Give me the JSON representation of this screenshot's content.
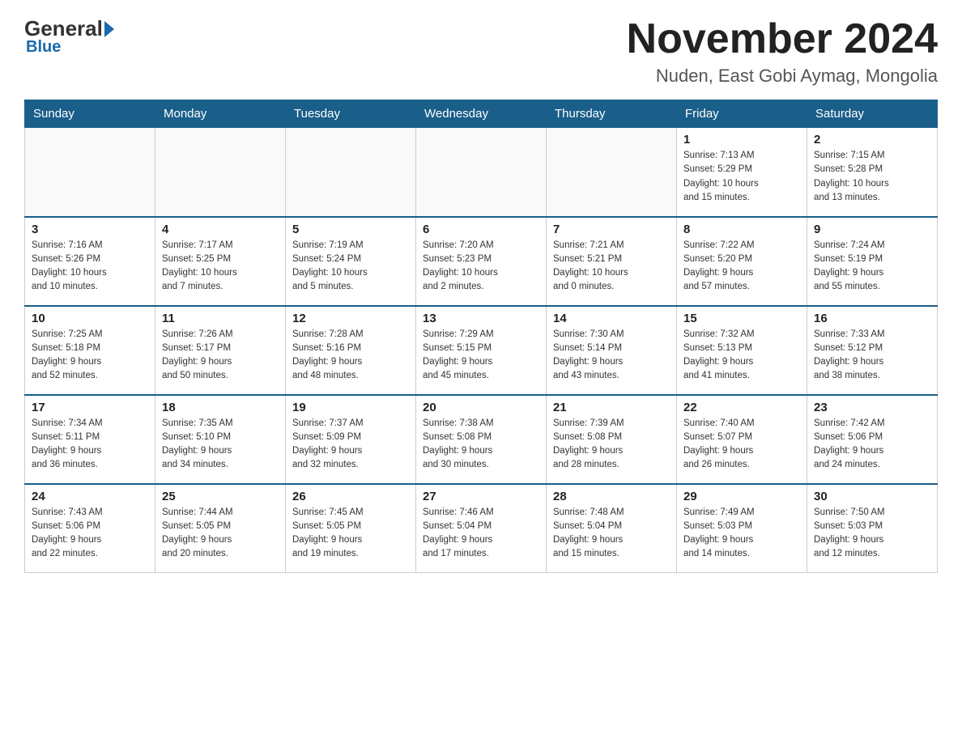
{
  "logo": {
    "general": "General",
    "blue": "Blue"
  },
  "title": "November 2024",
  "subtitle": "Nuden, East Gobi Aymag, Mongolia",
  "days_header": [
    "Sunday",
    "Monday",
    "Tuesday",
    "Wednesday",
    "Thursday",
    "Friday",
    "Saturday"
  ],
  "weeks": [
    [
      {
        "day": "",
        "info": ""
      },
      {
        "day": "",
        "info": ""
      },
      {
        "day": "",
        "info": ""
      },
      {
        "day": "",
        "info": ""
      },
      {
        "day": "",
        "info": ""
      },
      {
        "day": "1",
        "info": "Sunrise: 7:13 AM\nSunset: 5:29 PM\nDaylight: 10 hours\nand 15 minutes."
      },
      {
        "day": "2",
        "info": "Sunrise: 7:15 AM\nSunset: 5:28 PM\nDaylight: 10 hours\nand 13 minutes."
      }
    ],
    [
      {
        "day": "3",
        "info": "Sunrise: 7:16 AM\nSunset: 5:26 PM\nDaylight: 10 hours\nand 10 minutes."
      },
      {
        "day": "4",
        "info": "Sunrise: 7:17 AM\nSunset: 5:25 PM\nDaylight: 10 hours\nand 7 minutes."
      },
      {
        "day": "5",
        "info": "Sunrise: 7:19 AM\nSunset: 5:24 PM\nDaylight: 10 hours\nand 5 minutes."
      },
      {
        "day": "6",
        "info": "Sunrise: 7:20 AM\nSunset: 5:23 PM\nDaylight: 10 hours\nand 2 minutes."
      },
      {
        "day": "7",
        "info": "Sunrise: 7:21 AM\nSunset: 5:21 PM\nDaylight: 10 hours\nand 0 minutes."
      },
      {
        "day": "8",
        "info": "Sunrise: 7:22 AM\nSunset: 5:20 PM\nDaylight: 9 hours\nand 57 minutes."
      },
      {
        "day": "9",
        "info": "Sunrise: 7:24 AM\nSunset: 5:19 PM\nDaylight: 9 hours\nand 55 minutes."
      }
    ],
    [
      {
        "day": "10",
        "info": "Sunrise: 7:25 AM\nSunset: 5:18 PM\nDaylight: 9 hours\nand 52 minutes."
      },
      {
        "day": "11",
        "info": "Sunrise: 7:26 AM\nSunset: 5:17 PM\nDaylight: 9 hours\nand 50 minutes."
      },
      {
        "day": "12",
        "info": "Sunrise: 7:28 AM\nSunset: 5:16 PM\nDaylight: 9 hours\nand 48 minutes."
      },
      {
        "day": "13",
        "info": "Sunrise: 7:29 AM\nSunset: 5:15 PM\nDaylight: 9 hours\nand 45 minutes."
      },
      {
        "day": "14",
        "info": "Sunrise: 7:30 AM\nSunset: 5:14 PM\nDaylight: 9 hours\nand 43 minutes."
      },
      {
        "day": "15",
        "info": "Sunrise: 7:32 AM\nSunset: 5:13 PM\nDaylight: 9 hours\nand 41 minutes."
      },
      {
        "day": "16",
        "info": "Sunrise: 7:33 AM\nSunset: 5:12 PM\nDaylight: 9 hours\nand 38 minutes."
      }
    ],
    [
      {
        "day": "17",
        "info": "Sunrise: 7:34 AM\nSunset: 5:11 PM\nDaylight: 9 hours\nand 36 minutes."
      },
      {
        "day": "18",
        "info": "Sunrise: 7:35 AM\nSunset: 5:10 PM\nDaylight: 9 hours\nand 34 minutes."
      },
      {
        "day": "19",
        "info": "Sunrise: 7:37 AM\nSunset: 5:09 PM\nDaylight: 9 hours\nand 32 minutes."
      },
      {
        "day": "20",
        "info": "Sunrise: 7:38 AM\nSunset: 5:08 PM\nDaylight: 9 hours\nand 30 minutes."
      },
      {
        "day": "21",
        "info": "Sunrise: 7:39 AM\nSunset: 5:08 PM\nDaylight: 9 hours\nand 28 minutes."
      },
      {
        "day": "22",
        "info": "Sunrise: 7:40 AM\nSunset: 5:07 PM\nDaylight: 9 hours\nand 26 minutes."
      },
      {
        "day": "23",
        "info": "Sunrise: 7:42 AM\nSunset: 5:06 PM\nDaylight: 9 hours\nand 24 minutes."
      }
    ],
    [
      {
        "day": "24",
        "info": "Sunrise: 7:43 AM\nSunset: 5:06 PM\nDaylight: 9 hours\nand 22 minutes."
      },
      {
        "day": "25",
        "info": "Sunrise: 7:44 AM\nSunset: 5:05 PM\nDaylight: 9 hours\nand 20 minutes."
      },
      {
        "day": "26",
        "info": "Sunrise: 7:45 AM\nSunset: 5:05 PM\nDaylight: 9 hours\nand 19 minutes."
      },
      {
        "day": "27",
        "info": "Sunrise: 7:46 AM\nSunset: 5:04 PM\nDaylight: 9 hours\nand 17 minutes."
      },
      {
        "day": "28",
        "info": "Sunrise: 7:48 AM\nSunset: 5:04 PM\nDaylight: 9 hours\nand 15 minutes."
      },
      {
        "day": "29",
        "info": "Sunrise: 7:49 AM\nSunset: 5:03 PM\nDaylight: 9 hours\nand 14 minutes."
      },
      {
        "day": "30",
        "info": "Sunrise: 7:50 AM\nSunset: 5:03 PM\nDaylight: 9 hours\nand 12 minutes."
      }
    ]
  ]
}
